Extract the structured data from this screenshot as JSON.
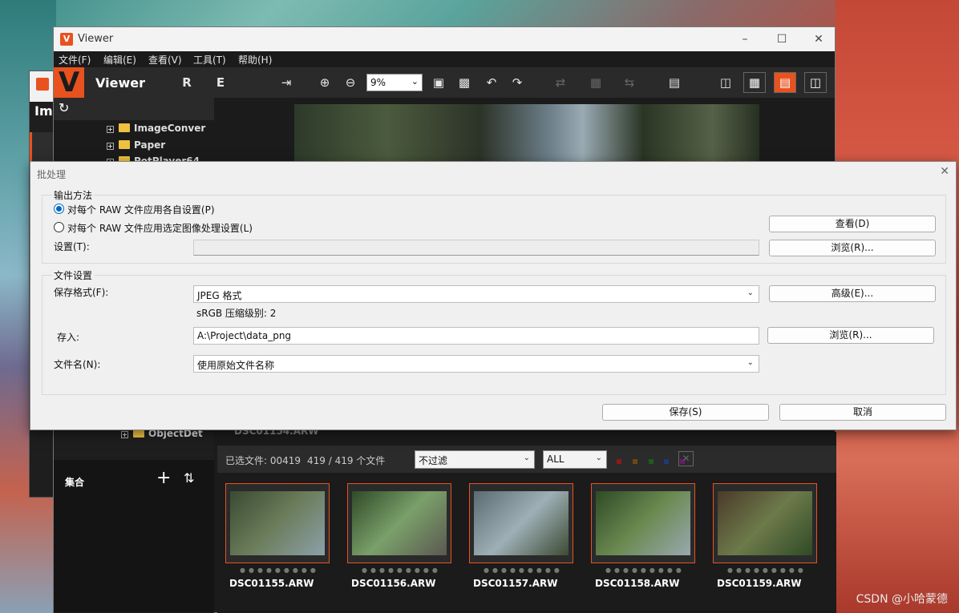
{
  "desktop": {
    "watermark": "CSDN @小哈蒙德"
  },
  "bg_app": {
    "title_partial": "Ima"
  },
  "viewer": {
    "window_title": "Viewer",
    "icon_letter": "V",
    "app_title": "Viewer",
    "menus": [
      "文件(F)",
      "编辑(E)",
      "查看(V)",
      "工具(T)",
      "帮助(H)"
    ],
    "zoom_value": "9%",
    "tree_items": [
      "ImageConver",
      "Paper",
      "PotPlayer64"
    ],
    "tree_bottom_item": "ObjectDet",
    "ghost_filename": "DSC01154.ARW",
    "collections_label": "集合",
    "selected_text": "已选文件: 00419",
    "count_text": "419 / 419 个文件",
    "filter_value": "不过滤",
    "rating_filter_value": "ALL",
    "color_dots": [
      "#8a1a1a",
      "#6b4a10",
      "#1f5a1f",
      "#1c3a7a",
      "#6a1a6a"
    ],
    "thumbnails": [
      {
        "name": "DSC01155.ARW",
        "colors": [
          "#3a4a32",
          "#6b7d5a",
          "#8da0aa"
        ]
      },
      {
        "name": "DSC01156.ARW",
        "colors": [
          "#2f4a28",
          "#7aa06a",
          "#5b5850"
        ]
      },
      {
        "name": "DSC01157.ARW",
        "colors": [
          "#5a6a70",
          "#9eb0b6",
          "#3d4a34"
        ]
      },
      {
        "name": "DSC01158.ARW",
        "colors": [
          "#2e4a26",
          "#6a8a50",
          "#9aa8b0"
        ]
      },
      {
        "name": "DSC01159.ARW",
        "colors": [
          "#4a3a2a",
          "#6d7a4a",
          "#2f4a26"
        ]
      }
    ]
  },
  "dialog": {
    "title": "批处理",
    "output_group": "输出方法",
    "radio_individual": "对每个 RAW 文件应用各自设置(P)",
    "radio_selected": "对每个 RAW 文件应用选定图像处理设置(L)",
    "view_button": "查看(D)",
    "settings_label": "设置(T):",
    "settings_value": "",
    "browse_button_1": "浏览(R)...",
    "file_group": "文件设置",
    "format_label": "保存格式(F):",
    "format_value": "JPEG 格式",
    "advanced_button": "高级(E)...",
    "format_info": "sRGB 压缩级别: 2",
    "save_to_label": "存入:",
    "save_to_value": "A:\\Project\\data_png",
    "browse_button_2": "浏览(R)...",
    "filename_label": "文件名(N):",
    "filename_value": "使用原始文件名称",
    "save_button": "保存(S)",
    "cancel_button": "取消"
  }
}
